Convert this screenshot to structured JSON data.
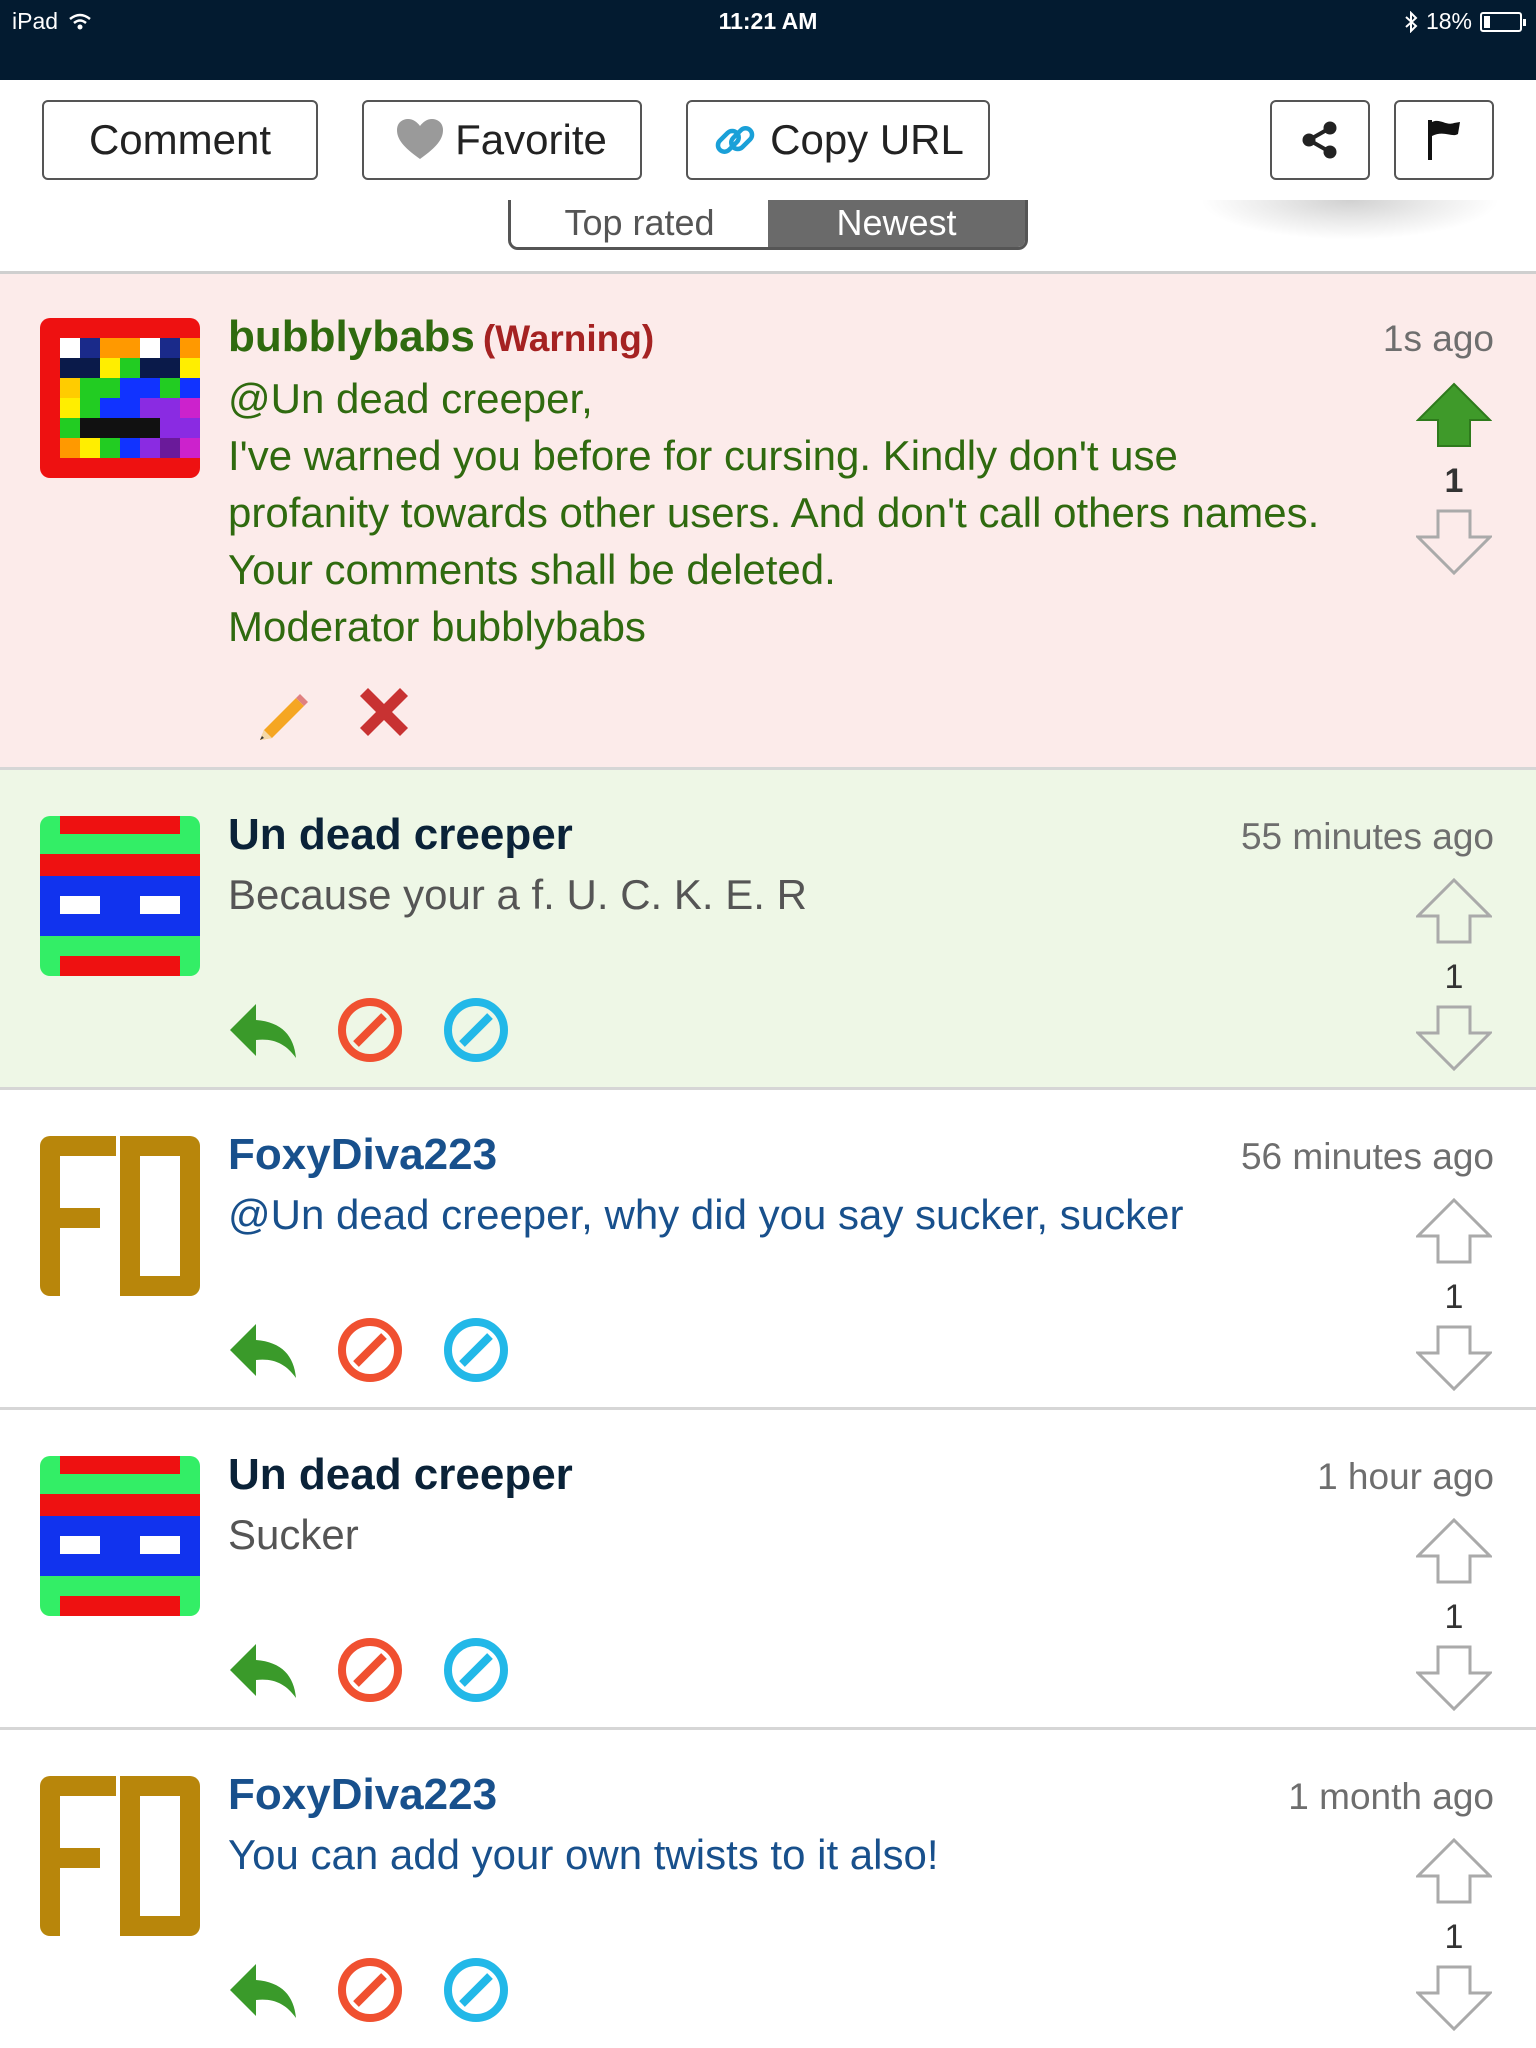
{
  "status_bar": {
    "device": "iPad",
    "time": "11:21 AM",
    "battery": "18%",
    "battery_level": 0.18
  },
  "toolbar": {
    "comment_label": "Comment",
    "favorite_label": "Favorite",
    "copy_url_label": "Copy URL"
  },
  "sort": {
    "top_rated": "Top rated",
    "newest": "Newest"
  },
  "comments": [
    {
      "username": "bubblybabs",
      "tag": "(Warning)",
      "time": "1s ago",
      "lines": [
        "@Un dead creeper,",
        "I've warned you before for cursing. Kindly don't use profanity towards other users. And don't call others names. Your comments shall be deleted.",
        "Moderator bubblybabs"
      ],
      "votes": "1",
      "voted_up": true
    },
    {
      "username": "Un dead creeper",
      "time": "55 minutes ago",
      "text": "Because your a f. U. C. K. E. R",
      "votes": "1"
    },
    {
      "username": "FoxyDiva223",
      "time": "56 minutes ago",
      "text": "@Un dead creeper, why did you say sucker, sucker",
      "votes": "1"
    },
    {
      "username": "Un dead creeper",
      "time": "1 hour ago",
      "text": "Sucker",
      "votes": "1"
    },
    {
      "username": "FoxyDiva223",
      "time": "1 month ago",
      "text": "You can add your own twists to it also!",
      "votes": "1"
    }
  ],
  "colors": {
    "status_bar": "#031b30",
    "warning_bg": "#fcebea",
    "highlight_bg": "#eef7e6",
    "moderator_green": "#2f6a0f",
    "warning_red": "#a52222",
    "user_blue": "#18508c",
    "reply_green": "#3a9a2a",
    "block_red": "#f05030",
    "ignore_blue": "#22b8e8"
  },
  "icons": [
    "wifi-icon",
    "bluetooth-icon",
    "battery-icon",
    "heart-icon",
    "link-icon",
    "share-icon",
    "flag-icon",
    "pencil-icon",
    "delete-icon",
    "reply-icon",
    "block-icon",
    "ignore-icon",
    "upvote-arrow-icon",
    "downvote-arrow-icon"
  ]
}
